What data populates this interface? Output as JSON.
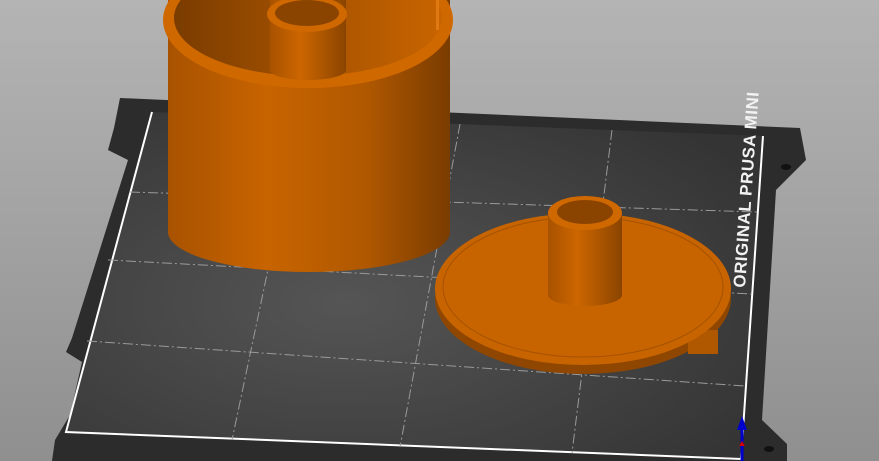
{
  "viewport": {
    "bed_logo": "ORIGINAL PRUSA MINI",
    "colors": {
      "model": "#c86400",
      "bed_frame": "#2c2c2c",
      "bed_surface": "#3c3c3c",
      "background": "#a8a8a8",
      "axis_z": "#0000cc",
      "axis_x": "#cc0000"
    },
    "objects": [
      {
        "name": "cylinder-container"
      },
      {
        "name": "disc-with-post"
      }
    ]
  }
}
